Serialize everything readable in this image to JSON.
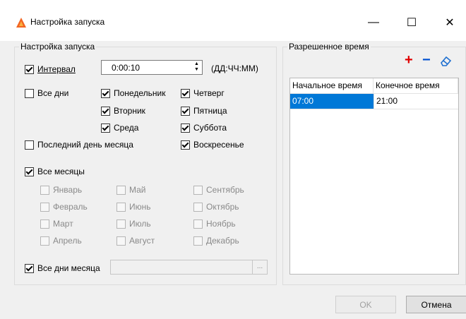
{
  "window": {
    "title": "Настройка запуска",
    "minimize_glyph": "—",
    "maximize_glyph": "☐",
    "close_glyph": "✕",
    "icon": "app-logo-icon"
  },
  "launch_group": {
    "label": "Настройка запуска",
    "interval": {
      "label": "Интервал",
      "checked": true,
      "value": "0:00:10",
      "format_hint": "(ДД:ЧЧ:ММ)"
    },
    "days": {
      "all_days": {
        "label": "Все дни",
        "checked": false
      },
      "weekdays": [
        {
          "label": "Понедельник",
          "checked": true
        },
        {
          "label": "Вторник",
          "checked": true
        },
        {
          "label": "Среда",
          "checked": true
        },
        {
          "label": "Четверг",
          "checked": true
        },
        {
          "label": "Пятница",
          "checked": true
        },
        {
          "label": "Суббота",
          "checked": true
        },
        {
          "label": "Воскресенье",
          "checked": true
        }
      ],
      "last_day": {
        "label": "Последний день месяца",
        "checked": false
      }
    },
    "months": {
      "all_months": {
        "label": "Все месяцы",
        "checked": true
      },
      "items": [
        {
          "label": "Январь",
          "checked": false
        },
        {
          "label": "Февраль",
          "checked": false
        },
        {
          "label": "Март",
          "checked": false
        },
        {
          "label": "Апрель",
          "checked": false
        },
        {
          "label": "Май",
          "checked": false
        },
        {
          "label": "Июнь",
          "checked": false
        },
        {
          "label": "Июль",
          "checked": false
        },
        {
          "label": "Август",
          "checked": false
        },
        {
          "label": "Сентябрь",
          "checked": false
        },
        {
          "label": "Октябрь",
          "checked": false
        },
        {
          "label": "Ноябрь",
          "checked": false
        },
        {
          "label": "Декабрь",
          "checked": false
        }
      ]
    },
    "all_month_days": {
      "label": "Все дни месяца",
      "checked": true,
      "value": "",
      "browse_label": "..."
    }
  },
  "allowed_time": {
    "label": "Разрешенное время",
    "add_label": "+",
    "remove_label": "−",
    "clear_icon": "eraser-icon",
    "columns": [
      "Начальное время",
      "Конечное время"
    ],
    "rows": [
      {
        "start": "07:00",
        "end": "21:00",
        "selected_cell": "start"
      }
    ]
  },
  "footer": {
    "ok_label": "OK",
    "cancel_label": "Отмена"
  },
  "colors": {
    "accent": "#0078d7",
    "add": "#e00000",
    "remove": "#0050d0",
    "icon_orange": "#f26522"
  }
}
